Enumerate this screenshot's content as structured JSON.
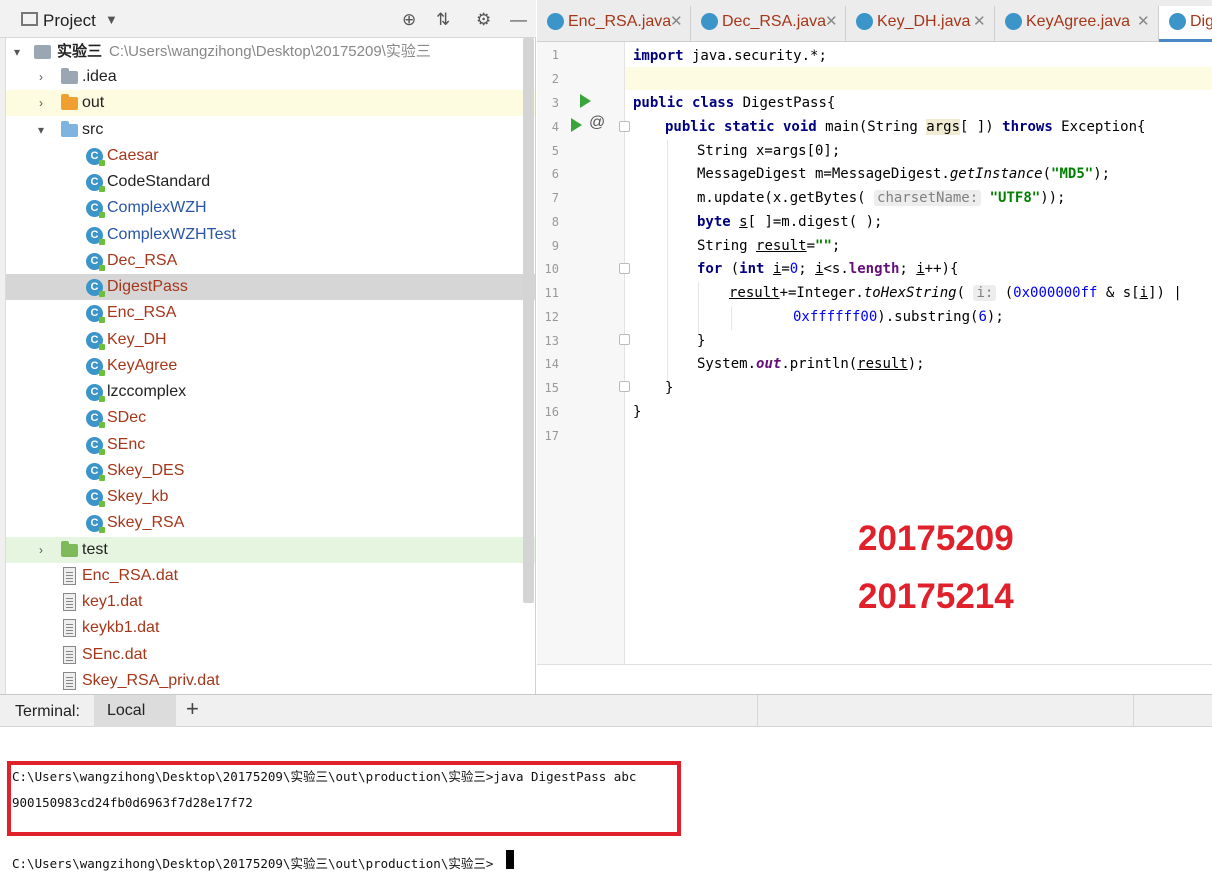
{
  "project_panel": {
    "title": "Project",
    "root": {
      "name": "实验三",
      "path": "C:\\Users\\wangzihong\\Desktop\\20175209\\实验三"
    },
    "items": [
      {
        "label": ".idea",
        "kind": "folder"
      },
      {
        "label": "out",
        "kind": "folder"
      },
      {
        "label": "src",
        "kind": "folder"
      },
      {
        "label": "Caesar",
        "kind": "class"
      },
      {
        "label": "CodeStandard",
        "kind": "class"
      },
      {
        "label": "ComplexWZH",
        "kind": "class"
      },
      {
        "label": "ComplexWZHTest",
        "kind": "class"
      },
      {
        "label": "Dec_RSA",
        "kind": "class"
      },
      {
        "label": "DigestPass",
        "kind": "class",
        "selected": true
      },
      {
        "label": "Enc_RSA",
        "kind": "class"
      },
      {
        "label": "Key_DH",
        "kind": "class"
      },
      {
        "label": "KeyAgree",
        "kind": "class"
      },
      {
        "label": "lzccomplex",
        "kind": "class"
      },
      {
        "label": "SDec",
        "kind": "class"
      },
      {
        "label": "SEnc",
        "kind": "class"
      },
      {
        "label": "Skey_DES",
        "kind": "class"
      },
      {
        "label": "Skey_kb",
        "kind": "class"
      },
      {
        "label": "Skey_RSA",
        "kind": "class"
      },
      {
        "label": "test",
        "kind": "folder"
      },
      {
        "label": "Enc_RSA.dat",
        "kind": "file"
      },
      {
        "label": "key1.dat",
        "kind": "file"
      },
      {
        "label": "keykb1.dat",
        "kind": "file"
      },
      {
        "label": "SEnc.dat",
        "kind": "file"
      },
      {
        "label": "Skey_RSA_priv.dat",
        "kind": "file"
      }
    ]
  },
  "tabs": [
    "Enc_RSA.java",
    "Dec_RSA.java",
    "Key_DH.java",
    "KeyAgree.java",
    "Dig"
  ],
  "line_numbers": [
    "1",
    "2",
    "3",
    "4",
    "5",
    "6",
    "7",
    "8",
    "9",
    "10",
    "11",
    "12",
    "13",
    "14",
    "15",
    "16",
    "17"
  ],
  "code": {
    "l1": [
      "import",
      " java.security.*;"
    ],
    "l3": [
      "public class",
      " DigestPass{"
    ],
    "l4": [
      "public static void",
      " main(String ",
      "args",
      "[ ]) ",
      "throws",
      " Exception{"
    ],
    "l5": "String x=args[0];",
    "l6": [
      "MessageDigest m=MessageDigest.",
      "getInstance",
      "(",
      "\"MD5\"",
      ");"
    ],
    "l7": [
      "m.update(x.getBytes( ",
      "charsetName:",
      " ",
      "\"UTF8\"",
      "));"
    ],
    "l8": [
      "byte",
      " ",
      "s",
      "[ ]=m.digest( );"
    ],
    "l9": [
      "String ",
      "result",
      "=",
      "\"\"",
      ";"
    ],
    "l10": [
      "for",
      " (",
      "int",
      " ",
      "i",
      "=",
      "0",
      "; ",
      "i",
      "<s.",
      "length",
      "; ",
      "i",
      "++){"
    ],
    "l11": [
      "result",
      "+=Integer.",
      "toHexString",
      "( ",
      "i:",
      " (",
      "0x000000ff",
      " & s[",
      "i",
      "]) |"
    ],
    "l12": [
      "0xffffff00",
      ").substring(",
      "6",
      ");"
    ],
    "l13": "}",
    "l14": [
      "System.",
      "out",
      ".println(",
      "result",
      ");"
    ],
    "l15": "}",
    "l16": "}"
  },
  "stamp": [
    "20175209",
    "20175214"
  ],
  "terminal": {
    "label": "Terminal:",
    "tab": "Local",
    "add": "+",
    "lines": [
      "C:\\Users\\wangzihong\\Desktop\\20175209\\实验三\\out\\production\\实验三>java DigestPass abc",
      "900150983cd24fb0d6963f7d28e17f72",
      "C:\\Users\\wangzihong\\Desktop\\20175209\\实验三\\out\\production\\实验三>"
    ]
  },
  "colors": {
    "accent_red": "#e0202a",
    "class_icon": "#3b95c9",
    "folder_blue": "#7fb3e0",
    "folder_orange": "#f0a030",
    "folder_green": "#7dbb5a"
  }
}
